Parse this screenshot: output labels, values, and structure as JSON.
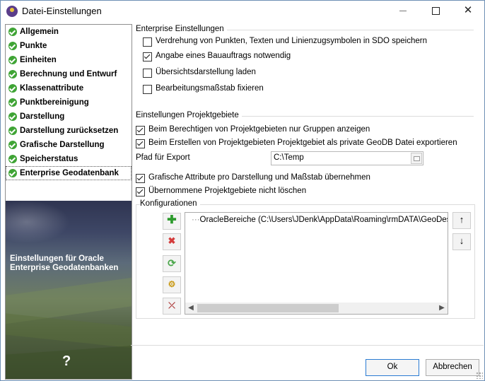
{
  "window": {
    "title": "Datei-Einstellungen"
  },
  "sidebar": {
    "items": [
      {
        "label": "Allgemein"
      },
      {
        "label": "Punkte"
      },
      {
        "label": "Einheiten"
      },
      {
        "label": "Berechnung und Entwurf"
      },
      {
        "label": "Klassenattribute"
      },
      {
        "label": "Punktbereinigung"
      },
      {
        "label": "Darstellung"
      },
      {
        "label": "Darstellung zurücksetzen"
      },
      {
        "label": "Grafische Darstellung"
      },
      {
        "label": "Speicherstatus"
      },
      {
        "label": "Enterprise Geodatenbank"
      }
    ],
    "selected": "Enterprise Geodatenbank",
    "caption": "Einstellungen für Oracle Enterprise Geodatenbanken",
    "help_glyph": "?"
  },
  "enterprise": {
    "legend": "Enterprise Einstellungen",
    "options": [
      {
        "label": "Verdrehung von Punkten, Texten und Linienzugsymbolen in SDO speichern",
        "checked": false
      },
      {
        "label": "Angabe eines Bauauftrags notwendig",
        "checked": true
      },
      {
        "label": "Übersichtsdarstellung laden",
        "checked": false
      },
      {
        "label": "Bearbeitungsmaßstab fixieren",
        "checked": false
      }
    ]
  },
  "projekt": {
    "legend": "Einstellungen Projektgebiete",
    "options_top": [
      {
        "label": "Beim Berechtigen von Projektgebieten nur Gruppen anzeigen",
        "checked": true
      },
      {
        "label": "Beim Erstellen von Projektgebieten Projektgebiet als private GeoDB Datei exportieren",
        "checked": true
      }
    ],
    "path_label": "Pfad für Export",
    "path_value": "C:\\Temp",
    "options_bottom": [
      {
        "label": "Grafische Attribute pro Darstellung und Maßstab übernehmen",
        "checked": true
      },
      {
        "label": "Übernommene Projektgebiete nicht löschen",
        "checked": true
      }
    ]
  },
  "konfig": {
    "legend": "Konfigurationen",
    "items": [
      "OracleBereiche (C:\\Users\\JDenk\\AppData\\Roaming\\rmDATA\\GeoDesktop"
    ],
    "item_prefix": "···"
  },
  "buttons": {
    "ok": "Ok",
    "cancel": "Abbrechen"
  }
}
